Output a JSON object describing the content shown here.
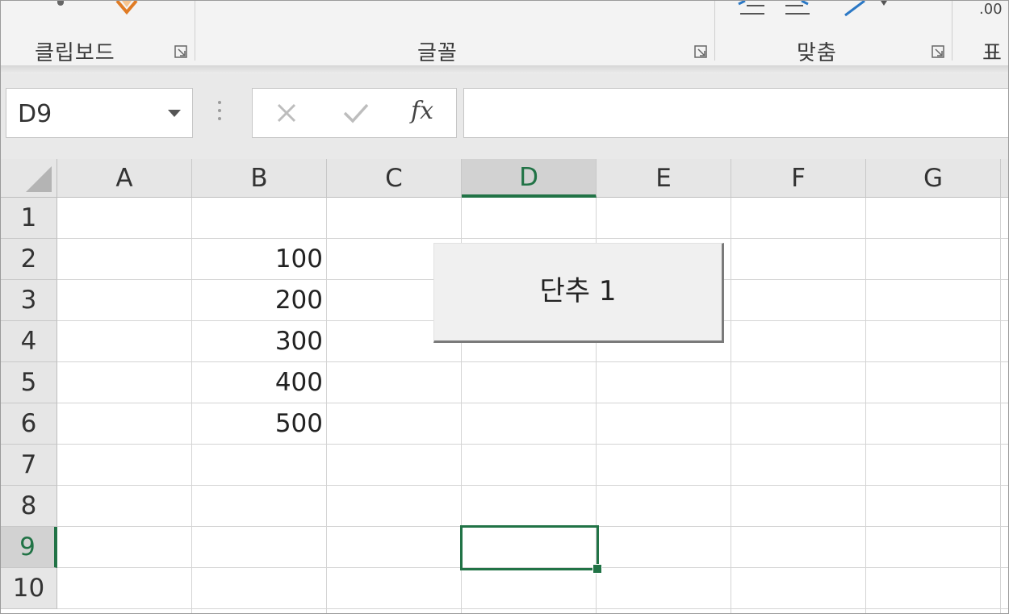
{
  "ribbon": {
    "groups": [
      {
        "label": "클립보드"
      },
      {
        "label": "글꼴"
      },
      {
        "label": "맞춤"
      },
      {
        "label": "표"
      }
    ],
    "number_fragment": ".00"
  },
  "formula_bar": {
    "name_box": "D9",
    "insert_function_label": "fx",
    "formula_value": ""
  },
  "sheet": {
    "columns": [
      "A",
      "B",
      "C",
      "D",
      "E",
      "F",
      "G"
    ],
    "rows": [
      "1",
      "2",
      "3",
      "4",
      "5",
      "6",
      "7",
      "8",
      "9",
      "10"
    ],
    "active_cell": "D9",
    "values": [
      {
        "cell": "B2",
        "value": "100"
      },
      {
        "cell": "B3",
        "value": "200"
      },
      {
        "cell": "B4",
        "value": "300"
      },
      {
        "cell": "B5",
        "value": "400"
      },
      {
        "cell": "B6",
        "value": "500"
      }
    ]
  },
  "form_button": {
    "label": "단추 1"
  },
  "colors": {
    "accent": "#217346",
    "header_bg": "#e6e6e6",
    "gridline": "#d4d4d4"
  }
}
